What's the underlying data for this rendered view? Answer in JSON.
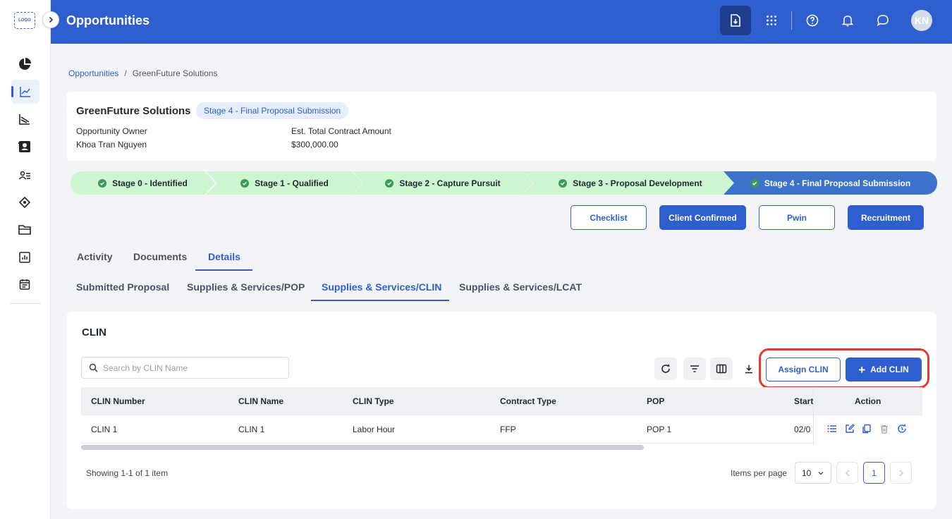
{
  "sidebar": {
    "logo_text": "LOGO",
    "items": [
      {
        "name": "dashboard-pie-icon"
      },
      {
        "name": "opportunities-chart-icon",
        "active": true
      },
      {
        "name": "pipeline-icon"
      },
      {
        "name": "contacts-icon"
      },
      {
        "name": "users-list-icon"
      },
      {
        "name": "tag-icon"
      },
      {
        "name": "folder-icon"
      },
      {
        "name": "reports-icon"
      },
      {
        "name": "calendar-icon"
      }
    ]
  },
  "header": {
    "title": "Opportunities",
    "avatar_initials": "KN"
  },
  "breadcrumb": {
    "root": "Opportunities",
    "separator": "/",
    "current": "GreenFuture Solutions"
  },
  "opportunity": {
    "name": "GreenFuture Solutions",
    "stage_badge": "Stage 4 - Final Proposal Submission",
    "owner_label": "Opportunity Owner",
    "owner_value": "Khoa Tran Nguyen",
    "amount_label": "Est. Total Contract Amount",
    "amount_value": "$300,000.00"
  },
  "stages": [
    {
      "label": "Stage 0 - Identified",
      "status": "done"
    },
    {
      "label": "Stage 1 - Qualified",
      "status": "done"
    },
    {
      "label": "Stage 2 - Capture Pursuit",
      "status": "done"
    },
    {
      "label": "Stage 3 - Proposal Development",
      "status": "done"
    },
    {
      "label": "Stage 4 - Final Proposal Submission",
      "status": "current"
    }
  ],
  "actions": {
    "checklist": "Checklist",
    "client_confirmed": "Client Confirmed",
    "pwin": "Pwin",
    "recruitment": "Recruitment"
  },
  "tabs": {
    "main": [
      "Activity",
      "Documents",
      "Details"
    ],
    "main_active": "Details",
    "sub": [
      "Submitted Proposal",
      "Supplies & Services/POP",
      "Supplies & Services/CLIN",
      "Supplies & Services/LCAT"
    ],
    "sub_active": "Supplies & Services/CLIN"
  },
  "clin": {
    "title": "CLIN",
    "search_placeholder": "Search by CLIN Name",
    "assign_label": "Assign CLIN",
    "add_label": "Add CLIN",
    "columns": [
      "CLIN Number",
      "CLIN Name",
      "CLIN Type",
      "Contract Type",
      "POP",
      "Start",
      "Action"
    ],
    "rows": [
      {
        "number": "CLIN 1",
        "name": "CLIN 1",
        "type": "Labor Hour",
        "contract_type": "FFP",
        "pop": "POP 1",
        "start": "02/0"
      }
    ],
    "showing": "Showing 1-1 of 1 item",
    "items_per_page_label": "Items per page",
    "items_per_page": "10",
    "current_page": "1"
  },
  "colors": {
    "primary": "#2f5fce",
    "header_bg": "#2f5fce",
    "stage_done": "#cdf5cf",
    "stage_current": "#3c72c9",
    "highlight": "#e23b2e"
  }
}
